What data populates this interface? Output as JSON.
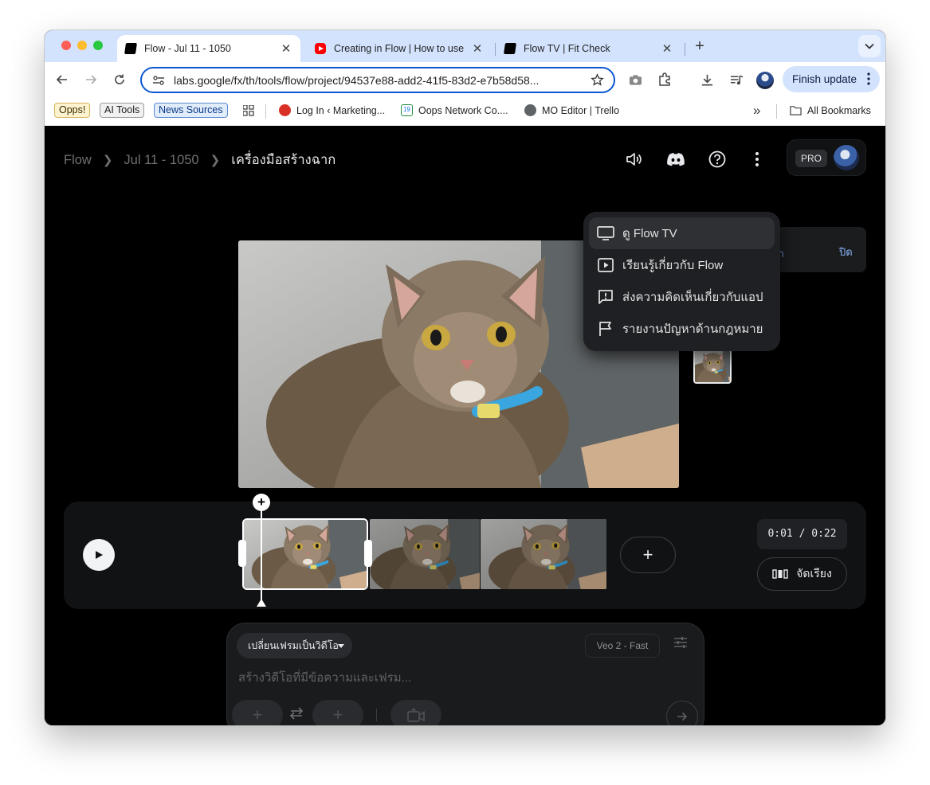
{
  "tabs": [
    {
      "title": "Flow - Jul 11 - 1050",
      "favicon": "flow-icon",
      "active": true
    },
    {
      "title": "Creating in Flow | How to use",
      "favicon": "youtube-icon",
      "active": false
    },
    {
      "title": "Flow TV | Fit Check",
      "favicon": "flow-icon",
      "active": false
    }
  ],
  "toolbar": {
    "url": "labs.google/fx/th/tools/flow/project/94537e88-add2-41f5-83d2-e7b58d58...",
    "finish_update_label": "Finish update"
  },
  "bookmarks": {
    "chips": [
      "Opps!",
      "AI Tools",
      "News Sources"
    ],
    "items": [
      "Log In ‹ Marketing...",
      "Oops Network Co....",
      "MO Editor | Trello"
    ],
    "more": "»",
    "all_bookmarks": "All Bookmarks"
  },
  "app": {
    "breadcrumb": [
      "Flow",
      "Jul 11 - 1050",
      "เครื่องมือสร้างฉาก"
    ],
    "pro_badge": "PRO",
    "notice": {
      "label": "ก",
      "close": "ปิด"
    },
    "menu": [
      {
        "label": "ดู Flow TV",
        "icon": "tv-icon"
      },
      {
        "label": "เรียนรู้เกี่ยวกับ Flow",
        "icon": "play-square-icon"
      },
      {
        "label": "ส่งความคิดเห็นเกี่ยวกับแอป",
        "icon": "feedback-icon"
      },
      {
        "label": "รายงานปัญหาด้านกฎหมาย",
        "icon": "flag-icon"
      }
    ],
    "timeline": {
      "timecode": "0:01 / 0:22",
      "arrange_label": "จัดเรียง",
      "clip_count": 3
    },
    "composer": {
      "mode": "เปลี่ยนเฟรมเป็นวิดีโอ",
      "model": "Veo 2 - Fast",
      "placeholder": "สร้างวิดีโอที่มีข้อความและเฟรม..."
    }
  },
  "colors": {
    "tab_strip": "#d3e3fd",
    "omnibox_border": "#0b57d0",
    "app_background": "#000000",
    "menu_background": "#1f2023"
  }
}
